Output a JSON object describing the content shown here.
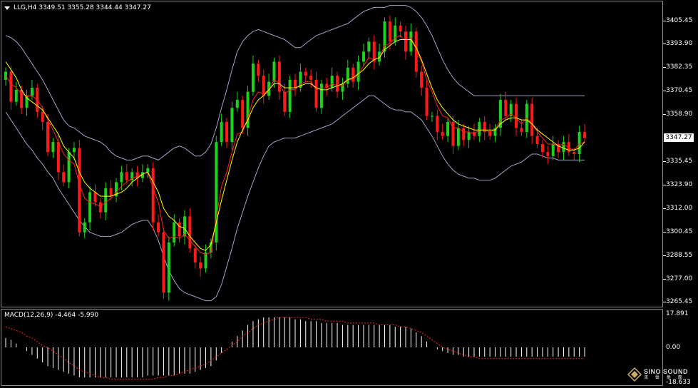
{
  "header": {
    "symbol_tf": "LLG,H4",
    "ohlc": "3349.51 3355.28 3344.44 3347.27"
  },
  "macd": {
    "label": "MACD(12,26,9) -4.464 -5.990",
    "axis_labels": [
      "17.891",
      "0.00",
      "-18.633"
    ]
  },
  "price_axis": {
    "labels": [
      "3405.45",
      "3393.90",
      "3382.35",
      "3370.45",
      "3358.90",
      "3335.45",
      "3323.90",
      "3312.00",
      "3300.45",
      "3288.55",
      "3277.00",
      "3265.45"
    ],
    "last_price": "3347.27"
  },
  "watermark": {
    "title": "SINO SOUND",
    "subtitle": "漢 聲 集 團"
  },
  "colors": {
    "bull": "#1fd11f",
    "bear": "#ff1a1a",
    "ma_fast": "#ffff00",
    "ma_slow": "#ff2020",
    "bands": "#9fa3c8",
    "macd_hist": "#ffffff",
    "macd_signal": "#ff2020",
    "background": "#000000"
  },
  "chart_data": {
    "type": "candlestick",
    "symbol": "LLG",
    "timeframe": "H4",
    "ylim": [
      3263,
      3415
    ],
    "closes": [
      3380,
      3365,
      3371,
      3362,
      3368,
      3372,
      3360,
      3355,
      3340,
      3345,
      3330,
      3325,
      3340,
      3342,
      3300,
      3305,
      3320,
      3315,
      3310,
      3322,
      3318,
      3325,
      3330,
      3326,
      3330,
      3327,
      3330,
      3332,
      3305,
      3300,
      3270,
      3295,
      3305,
      3298,
      3308,
      3292,
      3285,
      3282,
      3290,
      3295,
      3345,
      3355,
      3345,
      3362,
      3366,
      3352,
      3370,
      3384,
      3378,
      3368,
      3375,
      3385,
      3370,
      3360,
      3376,
      3372,
      3380,
      3378,
      3376,
      3362,
      3374,
      3372,
      3378,
      3370,
      3374,
      3382,
      3375,
      3385,
      3390,
      3395,
      3385,
      3390,
      3405,
      3395,
      3403,
      3400,
      3390,
      3400,
      3380,
      3372,
      3358,
      3358,
      3350,
      3348,
      3355,
      3343,
      3352,
      3346,
      3350,
      3348,
      3355,
      3350,
      3348,
      3352,
      3366,
      3358,
      3364,
      3352,
      3350,
      3364,
      3348,
      3344,
      3340,
      3338,
      3344,
      3340,
      3345,
      3340,
      3339,
      3350,
      3347
    ],
    "ma_fast": [
      3385,
      3381,
      3377,
      3371,
      3367,
      3365,
      3363,
      3361,
      3357,
      3353,
      3349,
      3343,
      3340,
      3337,
      3330,
      3325,
      3322,
      3320,
      3318,
      3318,
      3318,
      3319,
      3320,
      3322,
      3325,
      3327,
      3329,
      3330,
      3325,
      3320,
      3312,
      3308,
      3306,
      3303,
      3302,
      3298,
      3295,
      3292,
      3291,
      3294,
      3305,
      3316,
      3326,
      3336,
      3345,
      3351,
      3356,
      3362,
      3366,
      3368,
      3371,
      3374,
      3374,
      3372,
      3372,
      3372,
      3373,
      3374,
      3374,
      3372,
      3371,
      3371,
      3372,
      3373,
      3374,
      3376,
      3377,
      3379,
      3381,
      3384,
      3386,
      3387,
      3391,
      3393,
      3395,
      3396,
      3396,
      3396,
      3392,
      3386,
      3379,
      3372,
      3366,
      3362,
      3359,
      3356,
      3354,
      3353,
      3352,
      3351,
      3351,
      3351,
      3351,
      3351,
      3354,
      3356,
      3357,
      3357,
      3356,
      3356,
      3354,
      3351,
      3349,
      3347,
      3345,
      3343,
      3342,
      3341,
      3341,
      3342,
      3345
    ],
    "ma_slow": [
      3378,
      3374,
      3372,
      3369,
      3368,
      3368,
      3366,
      3362,
      3356,
      3351,
      3345,
      3339,
      3336,
      3334,
      3324,
      3317,
      3315,
      3314,
      3313,
      3315,
      3317,
      3320,
      3323,
      3325,
      3327,
      3328,
      3329,
      3330,
      3322,
      3315,
      3301,
      3297,
      3298,
      3297,
      3299,
      3296,
      3293,
      3290,
      3289,
      3290,
      3307,
      3323,
      3330,
      3340,
      3349,
      3350,
      3357,
      3366,
      3370,
      3369,
      3371,
      3376,
      3374,
      3369,
      3371,
      3371,
      3374,
      3375,
      3375,
      3371,
      3372,
      3372,
      3374,
      3373,
      3373,
      3376,
      3376,
      3379,
      3383,
      3387,
      3386,
      3387,
      3393,
      3394,
      3397,
      3398,
      3395,
      3397,
      3391,
      3385,
      3376,
      3370,
      3363,
      3358,
      3357,
      3352,
      3352,
      3350,
      3350,
      3349,
      3351,
      3351,
      3350,
      3351,
      3356,
      3357,
      3359,
      3357,
      3354,
      3357,
      3354,
      3350,
      3347,
      3344,
      3344,
      3343,
      3344,
      3342,
      3341,
      3344,
      3345
    ],
    "band_upper": [
      3398,
      3397,
      3395,
      3392,
      3388,
      3384,
      3380,
      3376,
      3371,
      3366,
      3361,
      3356,
      3353,
      3352,
      3350,
      3348,
      3347,
      3346,
      3345,
      3343,
      3340,
      3338,
      3337,
      3336,
      3336,
      3337,
      3338,
      3338,
      3337,
      3336,
      3338,
      3340,
      3342,
      3343,
      3342,
      3340,
      3338,
      3338,
      3340,
      3344,
      3352,
      3362,
      3371,
      3381,
      3390,
      3395,
      3398,
      3400,
      3401,
      3400,
      3399,
      3398,
      3397,
      3396,
      3394,
      3392,
      3392,
      3394,
      3396,
      3398,
      3399,
      3400,
      3401,
      3402,
      3403,
      3404,
      3406,
      3408,
      3410,
      3411,
      3412,
      3412,
      3412,
      3413,
      3413,
      3413,
      3413,
      3412,
      3410,
      3407,
      3403,
      3398,
      3392,
      3386,
      3381,
      3377,
      3374,
      3372,
      3370,
      3368,
      3368,
      3368,
      3368,
      3368,
      3368,
      3368,
      3368,
      3368,
      3368,
      3368,
      3368,
      3368,
      3368,
      3368,
      3368,
      3368,
      3368,
      3368,
      3368,
      3368,
      3368
    ],
    "band_lower": [
      3360,
      3356,
      3352,
      3348,
      3344,
      3341,
      3337,
      3334,
      3330,
      3327,
      3322,
      3318,
      3314,
      3310,
      3306,
      3303,
      3300,
      3299,
      3298,
      3298,
      3298,
      3299,
      3300,
      3302,
      3304,
      3305,
      3306,
      3306,
      3302,
      3296,
      3288,
      3281,
      3276,
      3272,
      3270,
      3269,
      3268,
      3267,
      3266,
      3266,
      3268,
      3274,
      3283,
      3292,
      3302,
      3310,
      3318,
      3325,
      3332,
      3338,
      3343,
      3345,
      3346,
      3347,
      3347,
      3347,
      3348,
      3349,
      3350,
      3351,
      3352,
      3353,
      3354,
      3356,
      3358,
      3360,
      3362,
      3364,
      3366,
      3368,
      3368,
      3366,
      3364,
      3362,
      3361,
      3361,
      3360,
      3360,
      3358,
      3356,
      3352,
      3348,
      3343,
      3338,
      3334,
      3331,
      3329,
      3328,
      3327,
      3327,
      3326,
      3326,
      3326,
      3327,
      3329,
      3331,
      3333,
      3334,
      3335,
      3337,
      3339,
      3339,
      3338,
      3337,
      3337,
      3336,
      3336,
      3336,
      3336,
      3336,
      3336
    ],
    "macd_ylim": [
      -18.633,
      17.891
    ],
    "macd_hist": [
      5,
      4,
      2,
      0,
      -2,
      -4,
      -6,
      -8,
      -10,
      -11,
      -12,
      -13,
      -14,
      -15,
      -16,
      -16,
      -16,
      -16,
      -16,
      -16,
      -16,
      -16,
      -16,
      -16,
      -16,
      -16,
      -16,
      -15,
      -15,
      -15,
      -15,
      -15,
      -15,
      -14,
      -14,
      -14,
      -13,
      -12,
      -11,
      -10,
      -7,
      -3,
      0,
      3,
      6,
      9,
      12,
      14,
      15,
      16,
      16,
      16,
      16,
      16,
      16,
      15,
      15,
      14,
      14,
      14,
      13,
      13,
      13,
      13,
      12,
      12,
      12,
      12,
      12,
      12,
      12,
      12,
      12,
      12,
      11,
      11,
      11,
      10,
      8,
      6,
      3,
      0,
      -1,
      -2,
      -3,
      -4,
      -4,
      -5,
      -5,
      -5,
      -5,
      -5,
      -5,
      -5,
      -5,
      -5,
      -5,
      -5,
      -5,
      -5,
      -5,
      -5,
      -5,
      -5,
      -5,
      -5,
      -5,
      -5,
      -5,
      -5,
      -5
    ],
    "macd_signal": [
      11,
      10,
      9,
      8,
      6,
      5,
      3,
      1,
      0,
      -2,
      -4,
      -6,
      -8,
      -10,
      -12,
      -13,
      -14,
      -15,
      -16,
      -16,
      -17,
      -17,
      -17,
      -17,
      -17,
      -17,
      -17,
      -17,
      -17,
      -16,
      -16,
      -15,
      -15,
      -14,
      -13,
      -12,
      -11,
      -10,
      -9,
      -7,
      -5,
      -3,
      -1,
      1,
      3,
      6,
      8,
      10,
      12,
      13,
      14,
      15,
      16,
      16,
      16,
      16,
      16,
      16,
      15,
      15,
      15,
      14,
      14,
      14,
      14,
      13,
      13,
      13,
      13,
      13,
      13,
      12,
      12,
      12,
      12,
      11,
      11,
      10,
      9,
      8,
      6,
      4,
      2,
      0,
      -1,
      -2,
      -3,
      -4,
      -5,
      -5,
      -6,
      -6,
      -6,
      -6,
      -6,
      -6,
      -6,
      -6,
      -6,
      -6,
      -6,
      -6,
      -6,
      -6,
      -6,
      -6,
      -6,
      -6,
      -6,
      -6,
      -6
    ]
  }
}
